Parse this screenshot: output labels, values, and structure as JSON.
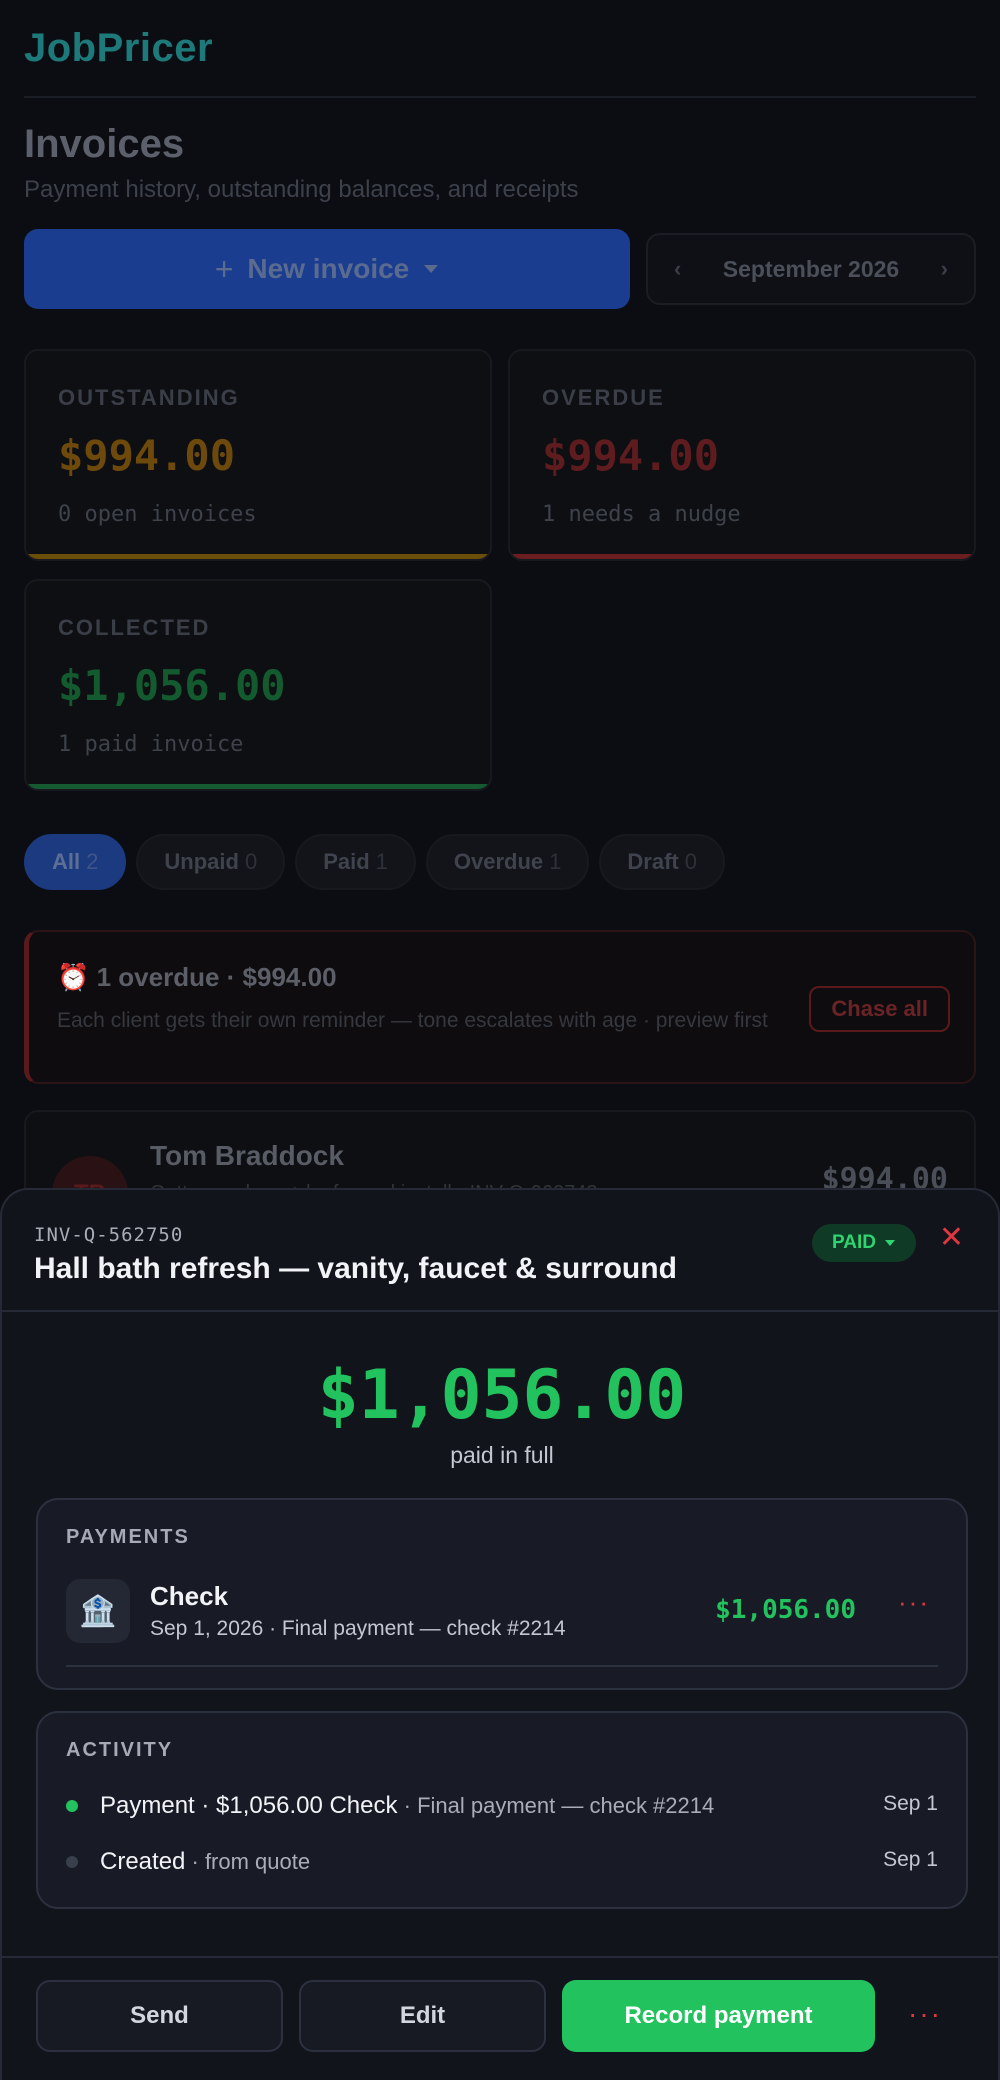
{
  "app": {
    "brand": "JobPricer"
  },
  "page": {
    "title": "Invoices",
    "subtitle": "Payment history, outstanding balances, and receipts"
  },
  "toolbar": {
    "new_invoice_label": "New invoice",
    "month_label": "September 2026"
  },
  "stats": {
    "outstanding": {
      "label": "OUTSTANDING",
      "value": "$994.00",
      "note": "0 open invoices",
      "color": "#8a5a0a"
    },
    "overdue": {
      "label": "OVERDUE",
      "value": "$994.00",
      "note": "1 needs a nudge",
      "color": "#6b1e20"
    },
    "collected": {
      "label": "COLLECTED",
      "value": "$1,056.00",
      "note": "1 paid invoice",
      "color": "#155a30"
    }
  },
  "filters": [
    {
      "label": "All",
      "count": "2"
    },
    {
      "label": "Unpaid",
      "count": "0"
    },
    {
      "label": "Paid",
      "count": "1"
    },
    {
      "label": "Overdue",
      "count": "1"
    },
    {
      "label": "Draft",
      "count": "0"
    }
  ],
  "overdue_banner": {
    "icon": "alarm-clock-icon",
    "title": "1 overdue · $994.00",
    "description": "Each client gets their own reminder — tone escalates with age · preview first",
    "action": "Chase all"
  },
  "invoice_row": {
    "initials": "TB",
    "client": "Tom Braddock",
    "description": "Gutter re-slope + leaf guard install · INV-Q-062743",
    "amount": "$994.00"
  },
  "sheet": {
    "invoice_id": "INV-Q-562750",
    "title": "Hall bath refresh — vanity, faucet & surround",
    "status": "PAID",
    "amount": "$1,056.00",
    "amount_caption": "paid in full",
    "payments_label": "PAYMENTS",
    "payment": {
      "icon": "bank-icon",
      "method": "Check",
      "meta": "Sep 1, 2026 · Final payment — check #2214",
      "amount": "$1,056.00"
    },
    "activity_label": "ACTIVITY",
    "activity": [
      {
        "main": "Payment · $1,056.00 Check",
        "rest": " · Final payment — check #2214",
        "date": "Sep 1",
        "dot_color": "#22c35e"
      },
      {
        "main": "Created",
        "rest": " · from quote",
        "date": "Sep 1",
        "dot_color": "#3a3f4d"
      }
    ],
    "actions": {
      "send": "Send",
      "edit": "Edit",
      "record": "Record payment"
    }
  }
}
